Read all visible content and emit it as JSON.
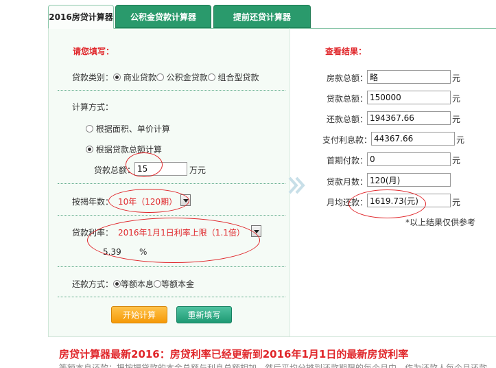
{
  "tabs": [
    {
      "label": "2016房贷计算器"
    },
    {
      "label": "公积金贷款计算器"
    },
    {
      "label": "提前还贷计算器"
    }
  ],
  "form": {
    "title": "请您填写：",
    "loan_type_label": "贷款类别：",
    "loan_types": [
      "商业贷款",
      "公积金贷款",
      "组合型贷款"
    ],
    "calc_method_label": "计算方式：",
    "calc_options": [
      "根据面积、单价计算",
      "根据贷款总额计算"
    ],
    "loan_total_label": "贷款总额：",
    "loan_total_value": "15",
    "loan_total_unit": "万元",
    "years_label": "按揭年数：",
    "years_value": "10年（120期）",
    "rate_label": "贷款利率：",
    "rate_value": "2016年1月1日利率上限（1.1倍）",
    "rate_number": "5.39",
    "rate_unit": "%",
    "repay_label": "还款方式：",
    "repay_options": [
      "等额本息",
      "等额本金"
    ],
    "start_button": "开始计算",
    "reset_button": "重新填写"
  },
  "results": {
    "title": "查看结果：",
    "rows": [
      {
        "label": "房款总额：",
        "value": "略",
        "unit": "元"
      },
      {
        "label": "贷款总额：",
        "value": "150000",
        "unit": "元"
      },
      {
        "label": "还款总额：",
        "value": "194367.66",
        "unit": "元"
      },
      {
        "label": "支付利息款：",
        "value": "44367.66",
        "unit": "元"
      },
      {
        "label": "首期付款：",
        "value": "0",
        "unit": "元"
      },
      {
        "label": "贷款月数：",
        "value": "120(月)",
        "unit": ""
      },
      {
        "label": "月均还款：",
        "value": "1619.73(元)",
        "unit": "元"
      }
    ],
    "note": "*以上结果仅供参考"
  },
  "bottom": {
    "headline": "房贷计算器最新2016：房贷利率已经更新到2016年1月1日的最新房贷利率",
    "cut_text": "等额本息还款：把按揭贷款的本金总额与利息总额相加，然后平均分摊到还款期限的每个月中，作为还款人每个月还款"
  },
  "colors": {
    "accent_red": "#e0262a",
    "tab_green": "#2a9a6c",
    "button_orange": "#f59a07",
    "button_green": "#1f9a74"
  }
}
